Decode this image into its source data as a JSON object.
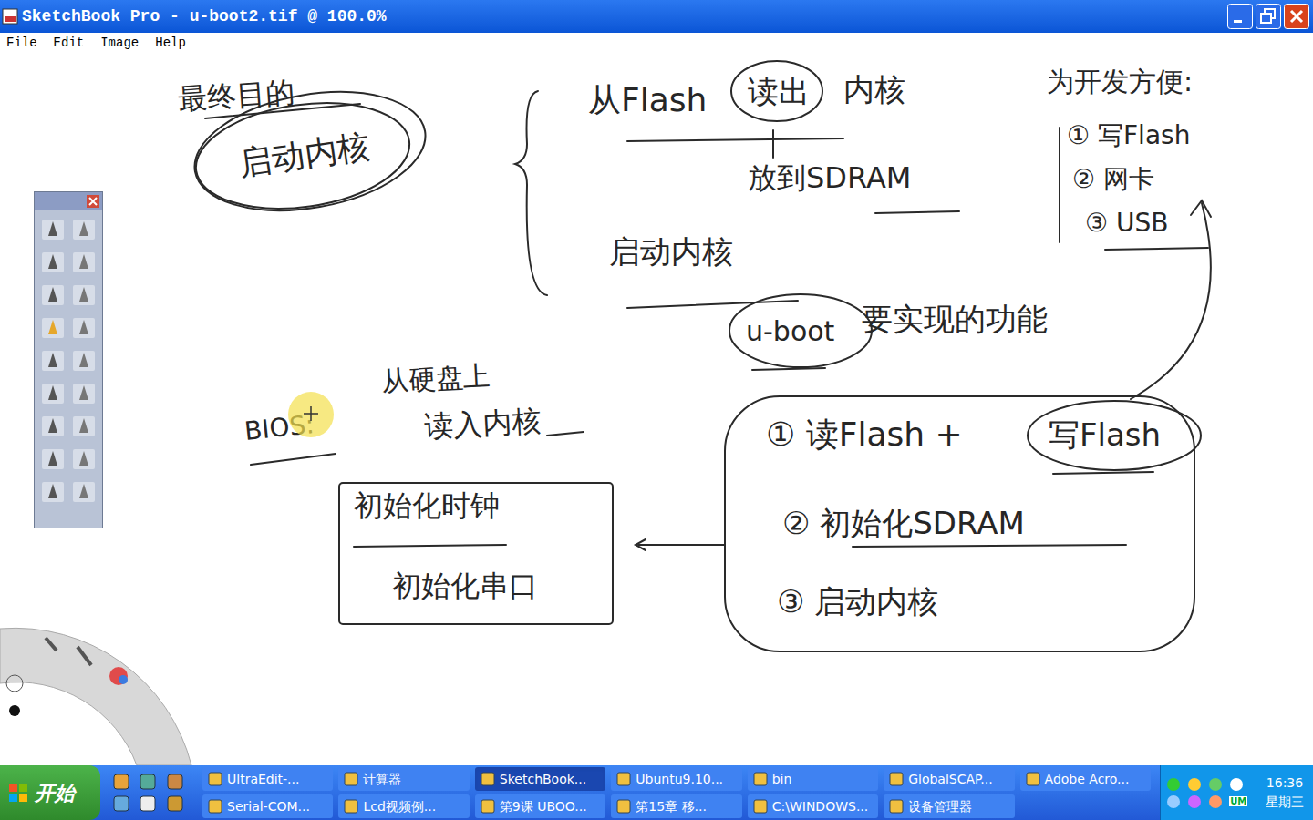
{
  "window": {
    "title": "SketchBook Pro - u-boot2.tif @ 100.0%"
  },
  "menu": [
    "File",
    "Edit",
    "Image",
    "Help"
  ],
  "canvas": {
    "notes": [
      "最终目的",
      "启动内核",
      "从Flash",
      "读出",
      "内核",
      "放到SDRAM",
      "启动内核",
      "为开发方便:",
      "① 写Flash",
      "② 网卡",
      "③ USB",
      "u-boot",
      "要实现的功能",
      "BIOS:",
      "从硬盘上",
      "读入内核",
      "初始化时钟",
      "初始化串口",
      "① 读Flash +",
      "写Flash",
      "② 初始化SDRAM",
      "③ 启动内核"
    ]
  },
  "taskbar": {
    "start": "开始",
    "tasks_top": [
      {
        "label": "UltraEdit-...",
        "selected": false
      },
      {
        "label": "计算器",
        "selected": false
      },
      {
        "label": "SketchBook...",
        "selected": true
      },
      {
        "label": "Ubuntu9.10...",
        "selected": false
      },
      {
        "label": "bin",
        "selected": false
      },
      {
        "label": "GlobalSCAP...",
        "selected": false
      },
      {
        "label": "Adobe Acro...",
        "selected": false
      }
    ],
    "tasks_bottom": [
      {
        "label": "Serial-COM...",
        "selected": false
      },
      {
        "label": "Lcd视频例...",
        "selected": false
      },
      {
        "label": "第9课 UBOO...",
        "selected": false
      },
      {
        "label": "第15章 移...",
        "selected": false
      },
      {
        "label": "C:\\WINDOWS...",
        "selected": false
      },
      {
        "label": "设备管理器",
        "selected": false
      }
    ],
    "tray_label": "UM",
    "clock": {
      "time": "16:36",
      "day": "星期三"
    }
  }
}
